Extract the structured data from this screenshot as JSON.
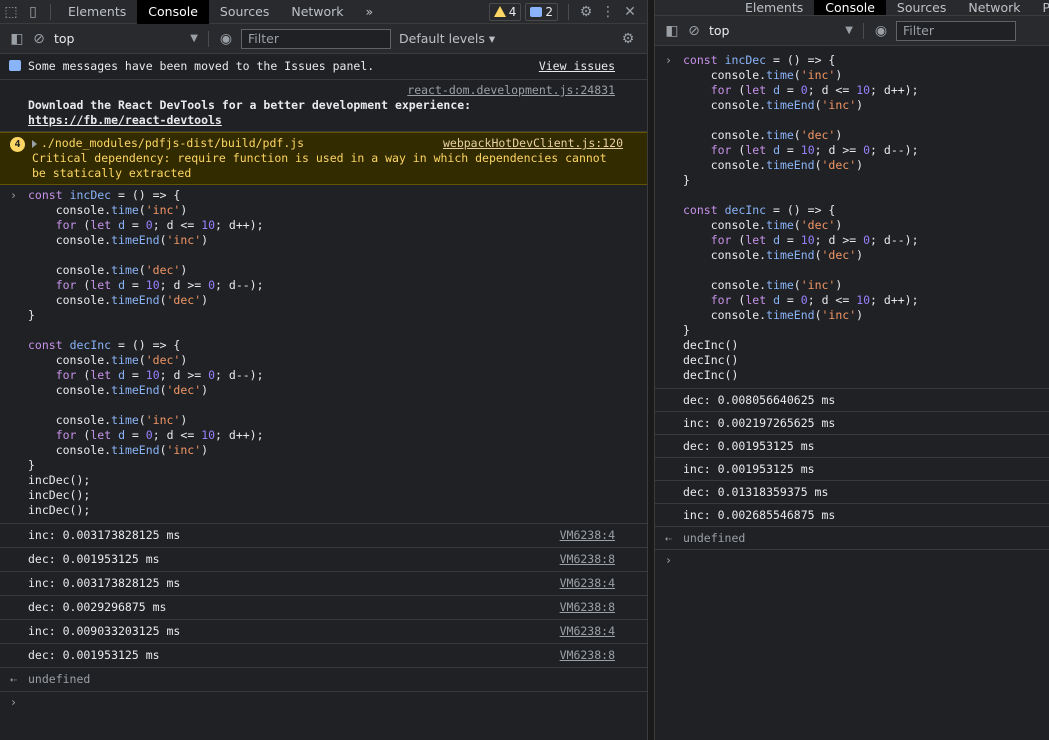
{
  "left": {
    "tabs": [
      "Elements",
      "Console",
      "Sources",
      "Network"
    ],
    "more_tabs": "»",
    "warn_count": "4",
    "msg_count": "2",
    "context": "top",
    "filter_placeholder": "Filter",
    "levels": "Default levels",
    "issues_msg": "Some messages have been moved to the Issues panel.",
    "view_issues": "View issues",
    "react_src": "react-dom.development.js:24831",
    "react_msg": "Download the React DevTools for a better development experience:",
    "react_link": "https://fb.me/react-devtools",
    "warning_badge": "4",
    "warning_path": "./node_modules/pdfjs-dist/build/pdf.js",
    "warning_src": "webpackHotDevClient.js:120",
    "warning_msg": "Critical dependency: require function is used in a way in which dependencies cannot be statically extracted",
    "calls": [
      "incDec();",
      "incDec();",
      "incDec();"
    ],
    "results": [
      {
        "text": "inc: 0.003173828125 ms",
        "src": "VM6238:4"
      },
      {
        "text": "dec: 0.001953125 ms",
        "src": "VM6238:8"
      },
      {
        "text": "inc: 0.003173828125 ms",
        "src": "VM6238:4"
      },
      {
        "text": "dec: 0.0029296875 ms",
        "src": "VM6238:8"
      },
      {
        "text": "inc: 0.009033203125 ms",
        "src": "VM6238:4"
      },
      {
        "text": "dec: 0.001953125 ms",
        "src": "VM6238:8"
      }
    ],
    "return_value": "undefined"
  },
  "right": {
    "tabs": [
      "Elements",
      "Console",
      "Sources",
      "Network",
      "P"
    ],
    "context": "top",
    "filter_placeholder": "Filter",
    "calls": [
      "decInc()",
      "decInc()",
      "decInc()"
    ],
    "results": [
      "dec: 0.008056640625 ms",
      "inc: 0.002197265625 ms",
      "dec: 0.001953125 ms",
      "inc: 0.001953125 ms",
      "dec: 0.01318359375 ms",
      "inc: 0.002685546875 ms"
    ],
    "return_value": "undefined"
  },
  "colors": {
    "background": "#202124",
    "toolbar": "#292a2d",
    "warning_bg": "#332b00",
    "warning_text": "#fdd663",
    "accent": "#8ab4f8"
  }
}
